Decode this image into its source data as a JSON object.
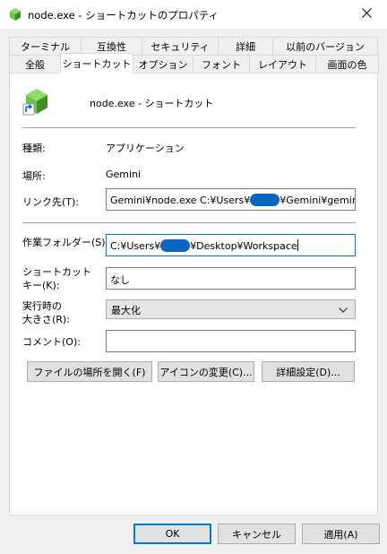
{
  "window": {
    "title": "node.exe - ショートカットのプロパティ"
  },
  "tabs_row1": [
    "ターミナル",
    "互換性",
    "セキュリティ",
    "詳細",
    "以前のバージョン"
  ],
  "tabs_row2": [
    "全般",
    "ショートカット",
    "オプション",
    "フォント",
    "レイアウト",
    "画面の色"
  ],
  "active_tab": "ショートカット",
  "header": {
    "name": "node.exe - ショートカット"
  },
  "info": {
    "type_label": "種類:",
    "type_value": "アプリケーション",
    "location_label": "場所:",
    "location_value": "Gemini"
  },
  "target": {
    "label": "リンク先(T):",
    "value_before": "Gemini¥node.exe C:¥Users¥",
    "value_after": "¥Gemini¥gemini.js"
  },
  "start_in": {
    "label": "作業フォルダー(S):",
    "value_before": "C:¥Users¥",
    "value_after": "¥Desktop¥Workspace"
  },
  "shortcut_key": {
    "label_line1": "ショートカット",
    "label_line2": "キー(K):",
    "value": "なし"
  },
  "run": {
    "label_line1": "実行時の",
    "label_line2": "大きさ(R):",
    "value": "最大化"
  },
  "comment": {
    "label": "コメント(O):",
    "value": ""
  },
  "actions": {
    "open_location": "ファイルの場所を開く(F)",
    "change_icon": "アイコンの変更(C)...",
    "advanced": "詳細設定(D)..."
  },
  "footer": {
    "ok": "OK",
    "cancel": "キャンセル",
    "apply": "適用(A)"
  },
  "colors": {
    "accent": "#0078d7",
    "redaction": "#0a64c2",
    "node_green": "#6cc24a"
  },
  "icons": [
    "node-app-icon",
    "close-icon",
    "shortcut-arrow-icon",
    "chevron-down-icon"
  ]
}
